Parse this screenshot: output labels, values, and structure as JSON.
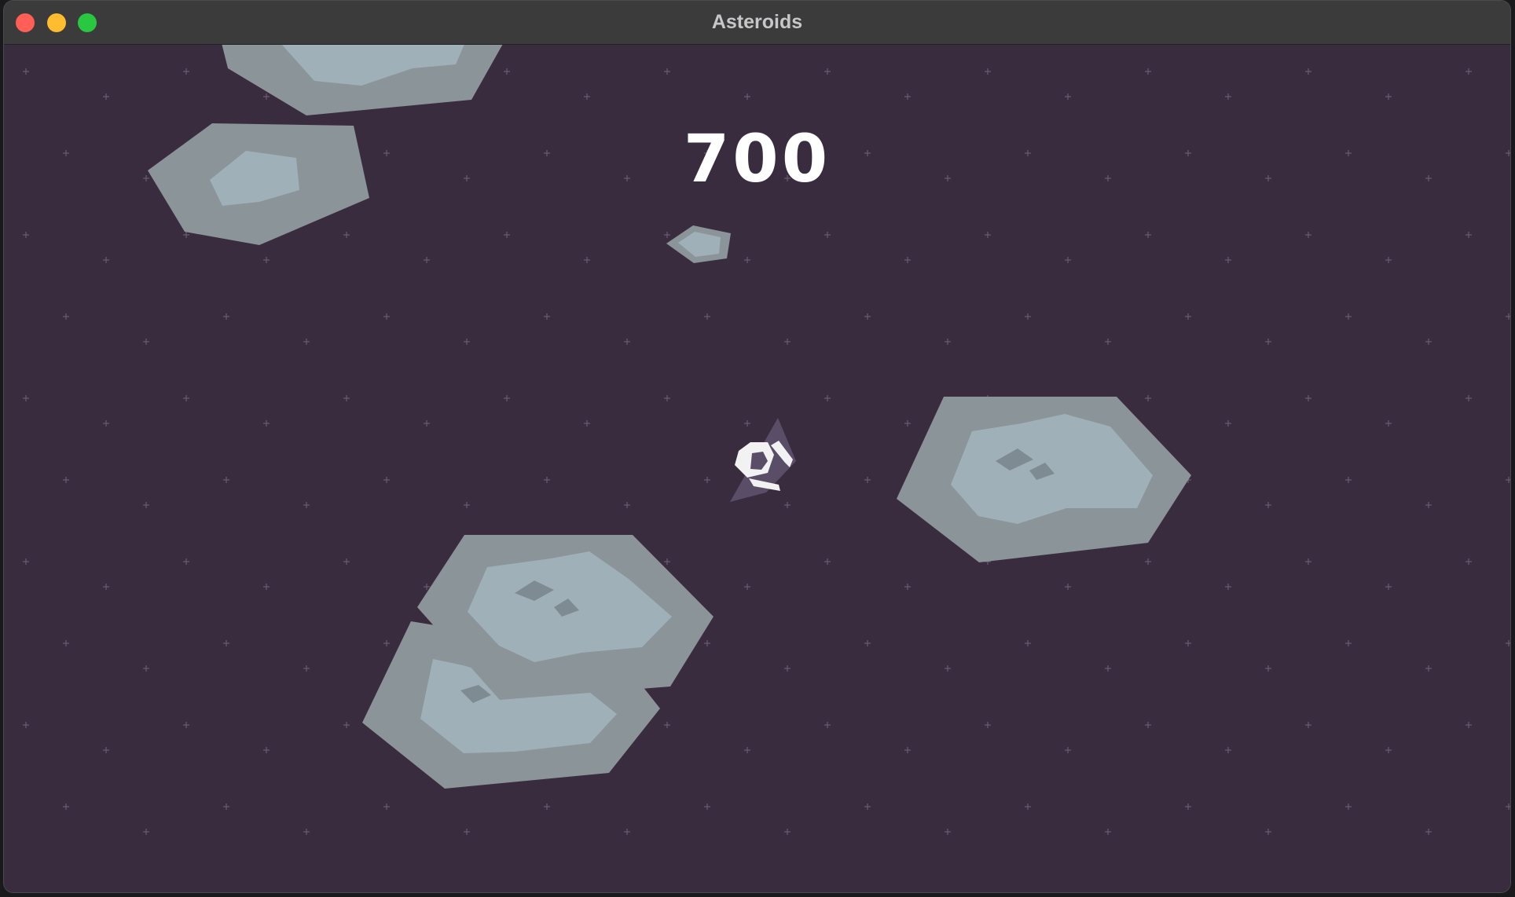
{
  "window": {
    "title": "Asteroids"
  },
  "game": {
    "score": "700",
    "colors": {
      "background": "#3a2c3f",
      "asteroid_outer": "#8a9499",
      "asteroid_inner": "#9fb0b8",
      "asteroid_crater": "#7f8b92",
      "ship_body": "#f2f2f2",
      "ship_shadow": "#5a4d68",
      "star": "#6c5a74",
      "close": "#ff5f57",
      "minimize": "#febc2e",
      "zoom": "#28c840"
    }
  }
}
